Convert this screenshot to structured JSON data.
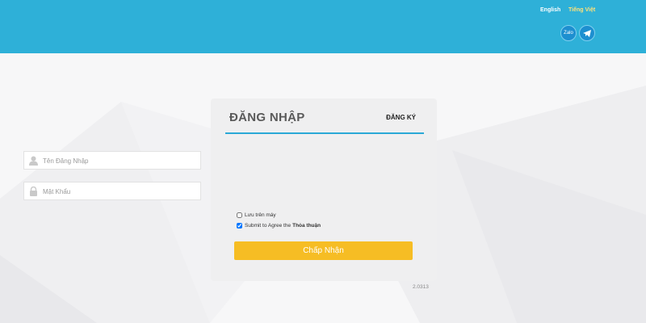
{
  "header": {
    "languages": [
      {
        "label": "English"
      },
      {
        "label": "Tiếng Việt"
      }
    ],
    "social": [
      {
        "icon": "zalo-icon",
        "label": "Zalo"
      },
      {
        "icon": "telegram-icon"
      }
    ],
    "color": "#2eb0d8"
  },
  "login": {
    "title": "ĐĂNG NHẬP",
    "register_label": "ĐĂNG KÝ",
    "username_placeholder": "Tên Đăng Nhập",
    "password_placeholder": "Mật Khẩu",
    "remember_label": "Lưu trên máy",
    "remember_checked": false,
    "agree_label": "Submit to Agree the",
    "agree_link": "Thỏa thuận",
    "agree_checked": true,
    "submit_label": "Chấp Nhận",
    "submit_color": "#f6bd24"
  },
  "version": "2.0313"
}
